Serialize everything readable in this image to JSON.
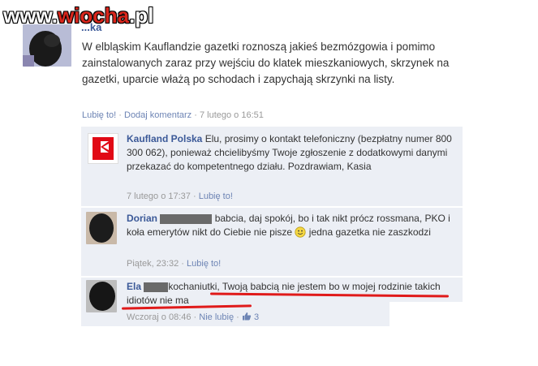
{
  "watermark": {
    "prefix": "www.",
    "brand": "wiocha",
    "suffix": ".pl"
  },
  "post": {
    "author_partial": "...ka",
    "text": "W elbląskim Kauflandzie gazetki roznoszą jakieś bezmózgowia i pomimo zainstalowanych zaraz przy wejściu do klatek mieszkaniowych, skrzynek na gazetki, uparcie włażą po schodach i zapychają skrzynki na listy.",
    "actions": {
      "like": "Lubię to!",
      "sep": "·",
      "comment": "Dodaj komentarz",
      "time": "7 lutego o 16:51"
    }
  },
  "comments": [
    {
      "author": "Kaufland Polska",
      "text": "Elu, prosimy o kontakt telefoniczny (bezpłatny numer 800 300 062), ponieważ chcielibyśmy Twoje zgłoszenie z dodatkowymi danymi przekazać do kompetentnego działu. Pozdrawiam, Kasia",
      "time": "7 lutego o 17:37",
      "like": "Lubię to!",
      "logo_text": "K"
    },
    {
      "author": "Dorian",
      "text_before_emoji": "babcia, daj spokój, bo i tak nikt prócz rossmana, PKO i koła emerytów nikt do Ciebie nie pisze",
      "text_after_emoji": "jedna gazetka nie zaszkodzi",
      "time": "Piątek, 23:32",
      "like": "Lubię to!"
    },
    {
      "author": "Ela",
      "text": "kochaniutki, Twoją babcią nie jestem bo w mojej rodzinie takich idiotów nie ma",
      "time": "Wczoraj o 08:46",
      "unlike": "Nie lubię",
      "likes_count": "3"
    }
  ],
  "colors": {
    "link": "#3b5998",
    "comment_bg": "#eceff5",
    "underline": "#e01a1a",
    "kaufland_red": "#e10915"
  }
}
